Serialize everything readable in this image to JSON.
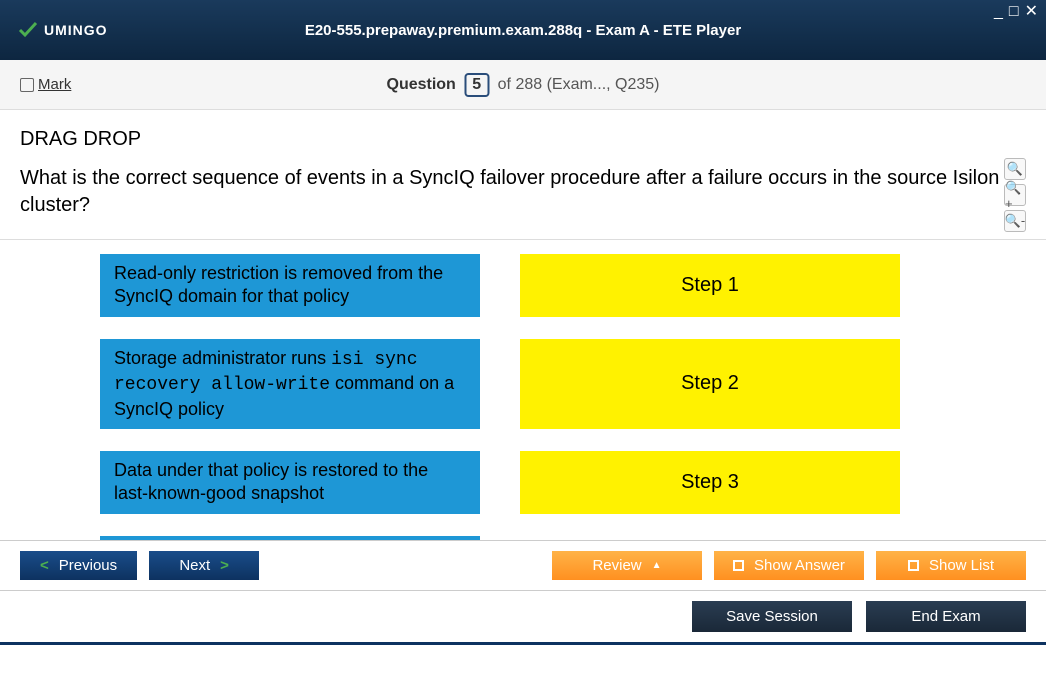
{
  "window": {
    "title": "E20-555.prepaway.premium.exam.288q - Exam A - ETE Player",
    "brand": "UMINGO"
  },
  "qbar": {
    "mark": "Mark",
    "question_label": "Question",
    "current": "5",
    "total_suffix": "of 288 (Exam..., Q235)"
  },
  "question": {
    "type": "DRAG DROP",
    "text": "What is the correct sequence of events in a SyncIQ failover procedure after a failure occurs in the source Isilon cluster?"
  },
  "drag_items": [
    "Read-only restriction is removed from the SyncIQ domain for that policy",
    "Storage administrator runs isi sync recovery allow-write command on a SyncIQ policy",
    "Data under that policy is restored to the last-known-good snapshot"
  ],
  "drop_slots": [
    "Step 1",
    "Step 2",
    "Step 3"
  ],
  "nav": {
    "previous": "Previous",
    "next": "Next",
    "review": "Review",
    "show_answer": "Show Answer",
    "show_list": "Show List"
  },
  "bottom": {
    "save": "Save Session",
    "end": "End Exam"
  }
}
